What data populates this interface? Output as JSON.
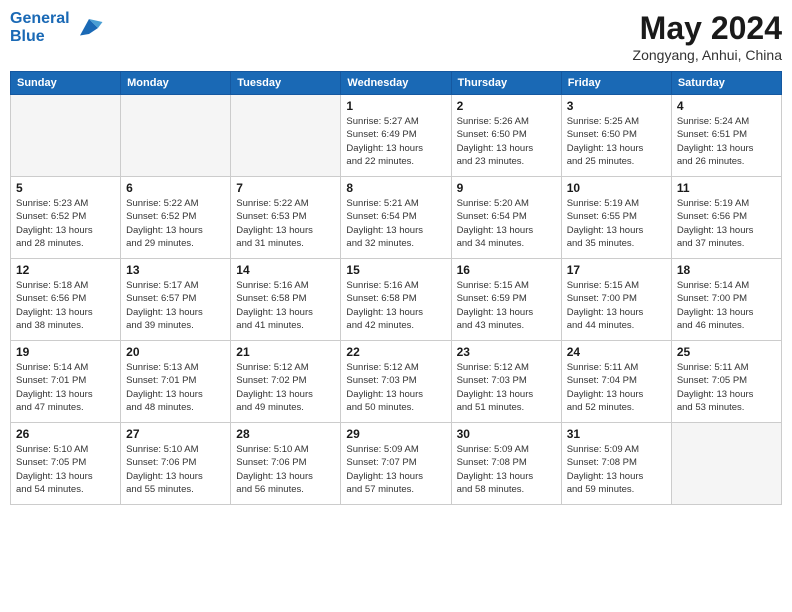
{
  "header": {
    "logo_line1": "General",
    "logo_line2": "Blue",
    "month": "May 2024",
    "location": "Zongyang, Anhui, China"
  },
  "weekdays": [
    "Sunday",
    "Monday",
    "Tuesday",
    "Wednesday",
    "Thursday",
    "Friday",
    "Saturday"
  ],
  "weeks": [
    [
      {
        "day": "",
        "empty": true
      },
      {
        "day": "",
        "empty": true
      },
      {
        "day": "",
        "empty": true
      },
      {
        "day": "1",
        "sunrise": "5:27 AM",
        "sunset": "6:49 PM",
        "daylight": "13 hours and 22 minutes."
      },
      {
        "day": "2",
        "sunrise": "5:26 AM",
        "sunset": "6:50 PM",
        "daylight": "13 hours and 23 minutes."
      },
      {
        "day": "3",
        "sunrise": "5:25 AM",
        "sunset": "6:50 PM",
        "daylight": "13 hours and 25 minutes."
      },
      {
        "day": "4",
        "sunrise": "5:24 AM",
        "sunset": "6:51 PM",
        "daylight": "13 hours and 26 minutes."
      }
    ],
    [
      {
        "day": "5",
        "sunrise": "5:23 AM",
        "sunset": "6:52 PM",
        "daylight": "13 hours and 28 minutes."
      },
      {
        "day": "6",
        "sunrise": "5:22 AM",
        "sunset": "6:52 PM",
        "daylight": "13 hours and 29 minutes."
      },
      {
        "day": "7",
        "sunrise": "5:22 AM",
        "sunset": "6:53 PM",
        "daylight": "13 hours and 31 minutes."
      },
      {
        "day": "8",
        "sunrise": "5:21 AM",
        "sunset": "6:54 PM",
        "daylight": "13 hours and 32 minutes."
      },
      {
        "day": "9",
        "sunrise": "5:20 AM",
        "sunset": "6:54 PM",
        "daylight": "13 hours and 34 minutes."
      },
      {
        "day": "10",
        "sunrise": "5:19 AM",
        "sunset": "6:55 PM",
        "daylight": "13 hours and 35 minutes."
      },
      {
        "day": "11",
        "sunrise": "5:19 AM",
        "sunset": "6:56 PM",
        "daylight": "13 hours and 37 minutes."
      }
    ],
    [
      {
        "day": "12",
        "sunrise": "5:18 AM",
        "sunset": "6:56 PM",
        "daylight": "13 hours and 38 minutes."
      },
      {
        "day": "13",
        "sunrise": "5:17 AM",
        "sunset": "6:57 PM",
        "daylight": "13 hours and 39 minutes."
      },
      {
        "day": "14",
        "sunrise": "5:16 AM",
        "sunset": "6:58 PM",
        "daylight": "13 hours and 41 minutes."
      },
      {
        "day": "15",
        "sunrise": "5:16 AM",
        "sunset": "6:58 PM",
        "daylight": "13 hours and 42 minutes."
      },
      {
        "day": "16",
        "sunrise": "5:15 AM",
        "sunset": "6:59 PM",
        "daylight": "13 hours and 43 minutes."
      },
      {
        "day": "17",
        "sunrise": "5:15 AM",
        "sunset": "7:00 PM",
        "daylight": "13 hours and 44 minutes."
      },
      {
        "day": "18",
        "sunrise": "5:14 AM",
        "sunset": "7:00 PM",
        "daylight": "13 hours and 46 minutes."
      }
    ],
    [
      {
        "day": "19",
        "sunrise": "5:14 AM",
        "sunset": "7:01 PM",
        "daylight": "13 hours and 47 minutes."
      },
      {
        "day": "20",
        "sunrise": "5:13 AM",
        "sunset": "7:01 PM",
        "daylight": "13 hours and 48 minutes."
      },
      {
        "day": "21",
        "sunrise": "5:12 AM",
        "sunset": "7:02 PM",
        "daylight": "13 hours and 49 minutes."
      },
      {
        "day": "22",
        "sunrise": "5:12 AM",
        "sunset": "7:03 PM",
        "daylight": "13 hours and 50 minutes."
      },
      {
        "day": "23",
        "sunrise": "5:12 AM",
        "sunset": "7:03 PM",
        "daylight": "13 hours and 51 minutes."
      },
      {
        "day": "24",
        "sunrise": "5:11 AM",
        "sunset": "7:04 PM",
        "daylight": "13 hours and 52 minutes."
      },
      {
        "day": "25",
        "sunrise": "5:11 AM",
        "sunset": "7:05 PM",
        "daylight": "13 hours and 53 minutes."
      }
    ],
    [
      {
        "day": "26",
        "sunrise": "5:10 AM",
        "sunset": "7:05 PM",
        "daylight": "13 hours and 54 minutes."
      },
      {
        "day": "27",
        "sunrise": "5:10 AM",
        "sunset": "7:06 PM",
        "daylight": "13 hours and 55 minutes."
      },
      {
        "day": "28",
        "sunrise": "5:10 AM",
        "sunset": "7:06 PM",
        "daylight": "13 hours and 56 minutes."
      },
      {
        "day": "29",
        "sunrise": "5:09 AM",
        "sunset": "7:07 PM",
        "daylight": "13 hours and 57 minutes."
      },
      {
        "day": "30",
        "sunrise": "5:09 AM",
        "sunset": "7:08 PM",
        "daylight": "13 hours and 58 minutes."
      },
      {
        "day": "31",
        "sunrise": "5:09 AM",
        "sunset": "7:08 PM",
        "daylight": "13 hours and 59 minutes."
      },
      {
        "day": "",
        "empty": true
      }
    ]
  ]
}
